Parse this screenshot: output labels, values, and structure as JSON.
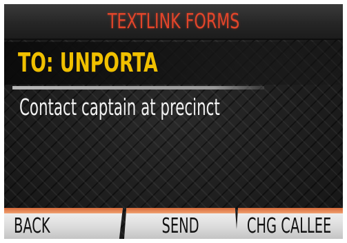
{
  "header": {
    "title": "TEXTLINK FORMS"
  },
  "recipient": {
    "label": "TO:  UNPORTA"
  },
  "message": {
    "body": "Contact captain at precinct"
  },
  "softkeys": [
    {
      "label": "BACK"
    },
    {
      "label": "SEND"
    },
    {
      "label": "CHG CALLEE"
    }
  ],
  "colors": {
    "title": "#e2452a",
    "recipient": "#f0c000",
    "message": "#f2f2f2",
    "softkey_accent": "#d86a3a"
  }
}
